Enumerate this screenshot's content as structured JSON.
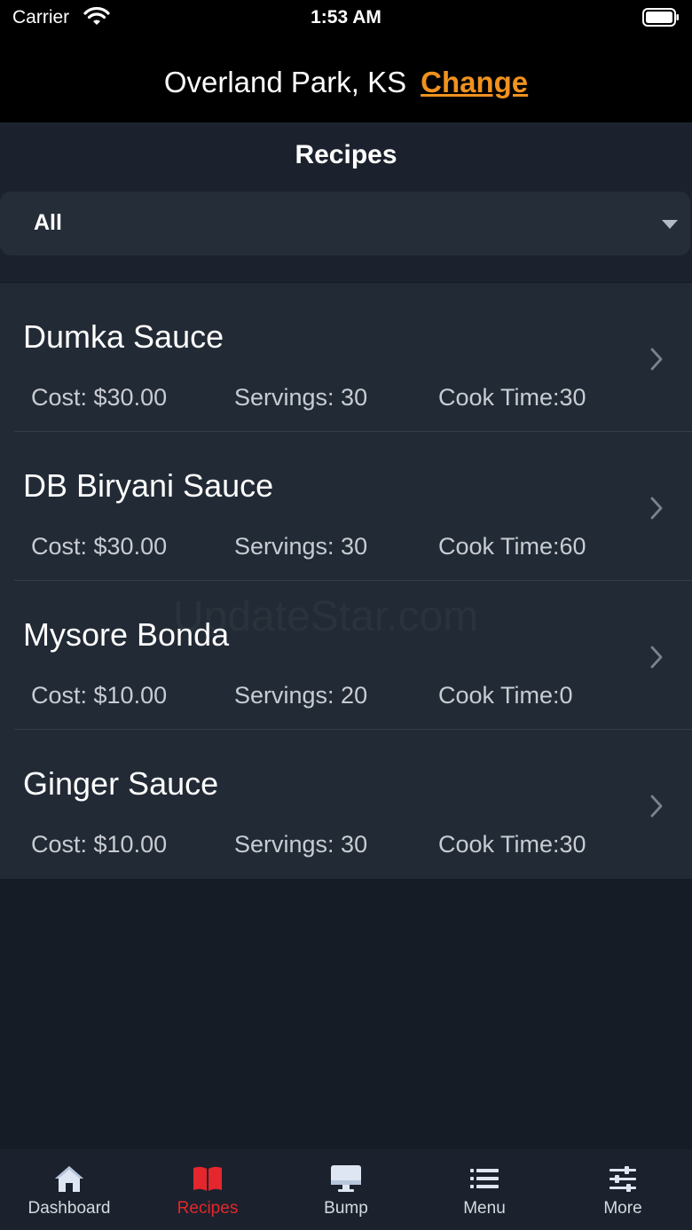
{
  "status_bar": {
    "carrier": "Carrier",
    "time": "1:53 AM",
    "icons": [
      "wifi-icon",
      "battery-icon"
    ]
  },
  "location": {
    "name": "Overland Park, KS",
    "change_label": "Change",
    "change_color": "#f0921e"
  },
  "page": {
    "title": "Recipes"
  },
  "filter": {
    "selected": "All"
  },
  "recipes": [
    {
      "name": "Dumka Sauce",
      "cost": "Cost: $30.00",
      "servings": "Servings: 30",
      "cook_time": "Cook Time:30"
    },
    {
      "name": "DB Biryani Sauce",
      "cost": "Cost: $30.00",
      "servings": "Servings: 30",
      "cook_time": "Cook Time:60"
    },
    {
      "name": "Mysore Bonda",
      "cost": "Cost: $10.00",
      "servings": "Servings: 20",
      "cook_time": "Cook Time:0"
    },
    {
      "name": "Ginger Sauce",
      "cost": "Cost: $10.00",
      "servings": "Servings: 30",
      "cook_time": "Cook Time:30"
    }
  ],
  "watermark": "UpdateStar.com",
  "tabs": [
    {
      "label": "Dashboard",
      "icon": "home-icon",
      "active": false
    },
    {
      "label": "Recipes",
      "icon": "book-icon",
      "active": true
    },
    {
      "label": "Bump",
      "icon": "monitor-icon",
      "active": false
    },
    {
      "label": "Menu",
      "icon": "list-icon",
      "active": false
    },
    {
      "label": "More",
      "icon": "sliders-icon",
      "active": false
    }
  ],
  "colors": {
    "accent_active": "#e5262c",
    "background": "#161c26",
    "row_background": "#222a35"
  }
}
